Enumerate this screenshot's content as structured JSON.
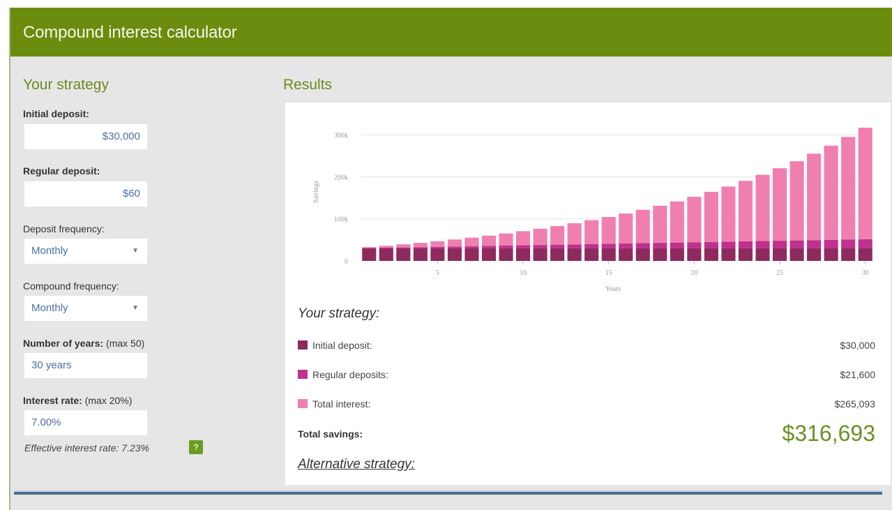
{
  "header": {
    "title": "Compound interest calculator"
  },
  "left": {
    "title": "Your strategy",
    "initial_deposit": {
      "label": "Initial deposit:",
      "value": "$30,000"
    },
    "regular_deposit": {
      "label": "Regular deposit:",
      "value": "$60"
    },
    "deposit_frequency": {
      "label": "Deposit frequency:",
      "value": "Monthly"
    },
    "compound_frequency": {
      "label": "Compound frequency:",
      "value": "Monthly"
    },
    "years": {
      "label": "Number of years:",
      "hint": "(max 50)",
      "value": "30 years"
    },
    "interest_rate": {
      "label": "Interest rate:",
      "hint": "(max 20%)",
      "value": "7.00%"
    },
    "effective_rate": "Effective interest rate: 7.23%",
    "help_icon": "?"
  },
  "results": {
    "title": "Results",
    "your_strategy": "Your strategy:",
    "rows": [
      {
        "label": "Initial deposit:",
        "value": "$30,000",
        "color": "#8e2b5e"
      },
      {
        "label": "Regular deposits:",
        "value": "$21,600",
        "color": "#c0308e"
      },
      {
        "label": "Total interest:",
        "value": "$265,093",
        "color": "#f07fb0"
      }
    ],
    "total_label": "Total savings:",
    "total_value": "$316,693",
    "alternative": "Alternative strategy:"
  },
  "chart_data": {
    "type": "bar",
    "stacked": true,
    "xlabel": "Years",
    "ylabel": "Savings",
    "ylim": [
      0,
      320000
    ],
    "yticks": [
      0,
      100000,
      200000,
      300000
    ],
    "ytick_labels": [
      "0",
      "100k",
      "200k",
      "300k"
    ],
    "xticks": [
      5,
      10,
      15,
      20,
      25,
      30
    ],
    "grid": true,
    "x": [
      1,
      2,
      3,
      4,
      5,
      6,
      7,
      8,
      9,
      10,
      11,
      12,
      13,
      14,
      15,
      16,
      17,
      18,
      19,
      20,
      21,
      22,
      23,
      24,
      25,
      26,
      27,
      28,
      29,
      30
    ],
    "series": [
      {
        "name": "Initial deposit",
        "color": "#8e2b5e",
        "values": [
          30000,
          30000,
          30000,
          30000,
          30000,
          30000,
          30000,
          30000,
          30000,
          30000,
          30000,
          30000,
          30000,
          30000,
          30000,
          30000,
          30000,
          30000,
          30000,
          30000,
          30000,
          30000,
          30000,
          30000,
          30000,
          30000,
          30000,
          30000,
          30000,
          30000
        ]
      },
      {
        "name": "Regular deposits",
        "color": "#c0308e",
        "values": [
          720,
          1440,
          2160,
          2880,
          3600,
          4320,
          5040,
          5760,
          6480,
          7200,
          7920,
          8640,
          9360,
          10080,
          10800,
          11520,
          12240,
          12960,
          13680,
          14400,
          15120,
          15840,
          16560,
          17280,
          18000,
          18720,
          19440,
          20160,
          20880,
          21600
        ]
      },
      {
        "name": "Total interest",
        "color": "#f07fb0",
        "values": [
          2192,
          4595,
          7224,
          10095,
          13225,
          16633,
          20340,
          24367,
          28737,
          33475,
          38608,
          44163,
          50173,
          56670,
          63687,
          71265,
          79442,
          88262,
          97772,
          108021,
          119063,
          130956,
          143760,
          157543,
          172374,
          188328,
          205489,
          223942,
          243781,
          265093
        ]
      }
    ]
  }
}
